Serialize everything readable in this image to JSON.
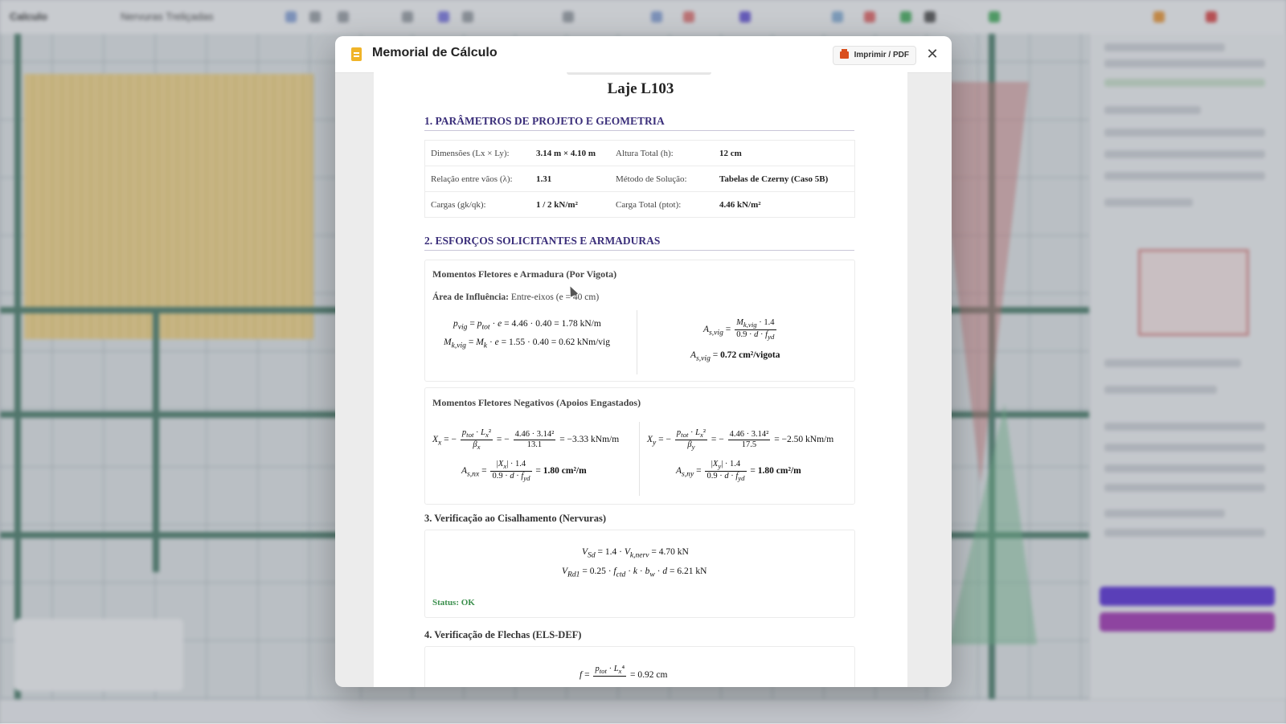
{
  "modal": {
    "title": "Memorial de Cálculo",
    "print_label": "Imprimir / PDF",
    "close_symbol": "✕"
  },
  "document": {
    "slab_name": "Laje L103",
    "section1": {
      "title": "1. PARÂMETROS DE PROJETO E GEOMETRIA",
      "rows": [
        {
          "label1": "Dimensões (Lx × Ly):",
          "value1": "3.14 m × 4.10 m",
          "label2": "Altura Total (h):",
          "value2": "12 cm"
        },
        {
          "label1": "Relação entre vãos (λ):",
          "value1": "1.31",
          "label2": "Método de Solução:",
          "value2": "Tabelas de Czerny (Caso 5B)"
        },
        {
          "label1": "Cargas (gk/qk):",
          "value1": "1 / 2 kN/m²",
          "label2": "Carga Total (ptot):",
          "value2": "4.46 kN/m²"
        }
      ]
    },
    "section2": {
      "title": "2. ESFORÇOS SOLICITANTES E ARMADURAS",
      "card1": {
        "title": "Momentos Fletores e Armadura (Por Vigota)",
        "influence_label": "Área de Influência:",
        "influence_value": "Entre-eixos (e = 40 cm)",
        "eq_pvig": "= 4.46 · 0.40 = 1.78 kN/m",
        "eq_mkvig": "= 1.55 · 0.40 = 0.62 kNm/vig",
        "eq_asvig_result": "0.72 cm²/vigota"
      },
      "card2": {
        "title": "Momentos Fletores Negativos (Apoios Engastados)",
        "xx_num": "4.46 · 3.14²",
        "xx_den": "13.1",
        "xx_result": "= −3.33 kNm/m",
        "xy_num": "4.46 · 3.14²",
        "xy_den": "17.5",
        "xy_result": "= −2.50 kNm/m",
        "asnx_result": "1.80 cm²/m",
        "asny_result": "1.80 cm²/m"
      }
    },
    "section3": {
      "title": "3. Verificação ao Cisalhamento (Nervuras)",
      "vsd_result": "= 4.70 kN",
      "vrd1_result": "= 6.21 kN",
      "status": "Status: OK"
    },
    "section4": {
      "title": "4. Verificação de Flechas (ELS-DEF)",
      "partial_result": "= 0.92 cm"
    }
  },
  "background": {
    "app_name": "Calculo",
    "project_name": "Nervuras Treliçadas"
  },
  "colors": {
    "accent_heading": "#3b2f7a",
    "status_ok": "#3b8f4d",
    "print_icon": "#d94f1e",
    "doc_icon": "#f0b429"
  }
}
